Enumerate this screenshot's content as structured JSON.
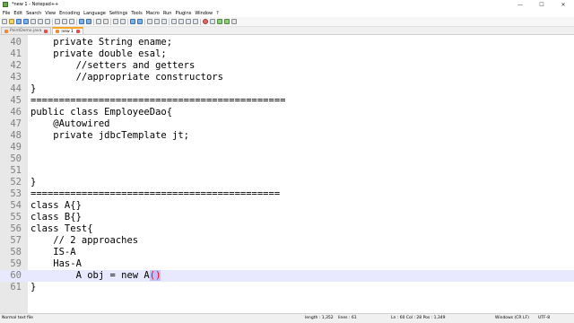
{
  "window": {
    "title": "*new 1 - Notepad++",
    "controls": [
      "—",
      "☐",
      "✕"
    ]
  },
  "menu": [
    "File",
    "Edit",
    "Search",
    "View",
    "Encoding",
    "Language",
    "Settings",
    "Tools",
    "Macro",
    "Run",
    "Plugins",
    "Window",
    "?"
  ],
  "tabs": [
    {
      "label": "PointDemo.java",
      "active": false
    },
    {
      "label": "new 1",
      "active": true
    }
  ],
  "lines": [
    {
      "num": "40",
      "text": "    private String ename;"
    },
    {
      "num": "41",
      "text": "    private double esal;"
    },
    {
      "num": "42",
      "text": "        //setters and getters"
    },
    {
      "num": "43",
      "text": "        //appropriate constructors"
    },
    {
      "num": "44",
      "text": "}"
    },
    {
      "num": "45",
      "text": "============================================="
    },
    {
      "num": "46",
      "text": "public class EmployeeDao{"
    },
    {
      "num": "47",
      "text": "    @Autowired"
    },
    {
      "num": "48",
      "text": "    private jdbcTemplate jt;"
    },
    {
      "num": "49",
      "text": ""
    },
    {
      "num": "50",
      "text": ""
    },
    {
      "num": "51",
      "text": ""
    },
    {
      "num": "52",
      "text": "}"
    },
    {
      "num": "53",
      "text": "============================================"
    },
    {
      "num": "54",
      "text": "class A{}"
    },
    {
      "num": "55",
      "text": "class B{}"
    },
    {
      "num": "56",
      "text": "class Test{"
    },
    {
      "num": "57",
      "text": "    // 2 approaches"
    },
    {
      "num": "58",
      "text": "    IS-A"
    },
    {
      "num": "59",
      "text": "    Has-A"
    },
    {
      "num": "60",
      "text": "        A obj = new A",
      "paren": "()",
      "current": true
    },
    {
      "num": "61",
      "text": "}"
    }
  ],
  "status": {
    "file_type": "Normal text file",
    "length": "length : 1,352",
    "lines": "lines : 61",
    "position": "Ln : 60   Col : 28   Pos : 1,349",
    "eol": "Windows (CR LF)",
    "encoding": "UTF-8"
  },
  "colors": {
    "gutter": "#e8e8e8",
    "current_line": "#e8e8ff",
    "line_number": "#808080",
    "active_tab_accent": "#f5a623",
    "brace_highlight": "#ff0000"
  }
}
